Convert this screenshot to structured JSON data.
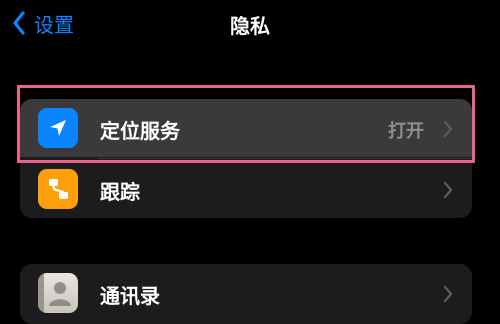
{
  "nav": {
    "back_label": "设置",
    "title": "隐私"
  },
  "rows": [
    {
      "label": "定位服务",
      "value": "打开",
      "icon": "location-arrow-icon"
    },
    {
      "label": "跟踪",
      "icon": "tracking-icon"
    },
    {
      "label": "通讯录",
      "icon": "contacts-icon"
    }
  ],
  "colors": {
    "background": "#000000",
    "cell": "#1c1c1e",
    "selected_cell": "#3a3a3c",
    "accent_blue": "#0a84ff",
    "tracking_orange": "#ff9f0a",
    "highlight_pink": "#e8628a",
    "secondary_text": "#8e8e93"
  }
}
